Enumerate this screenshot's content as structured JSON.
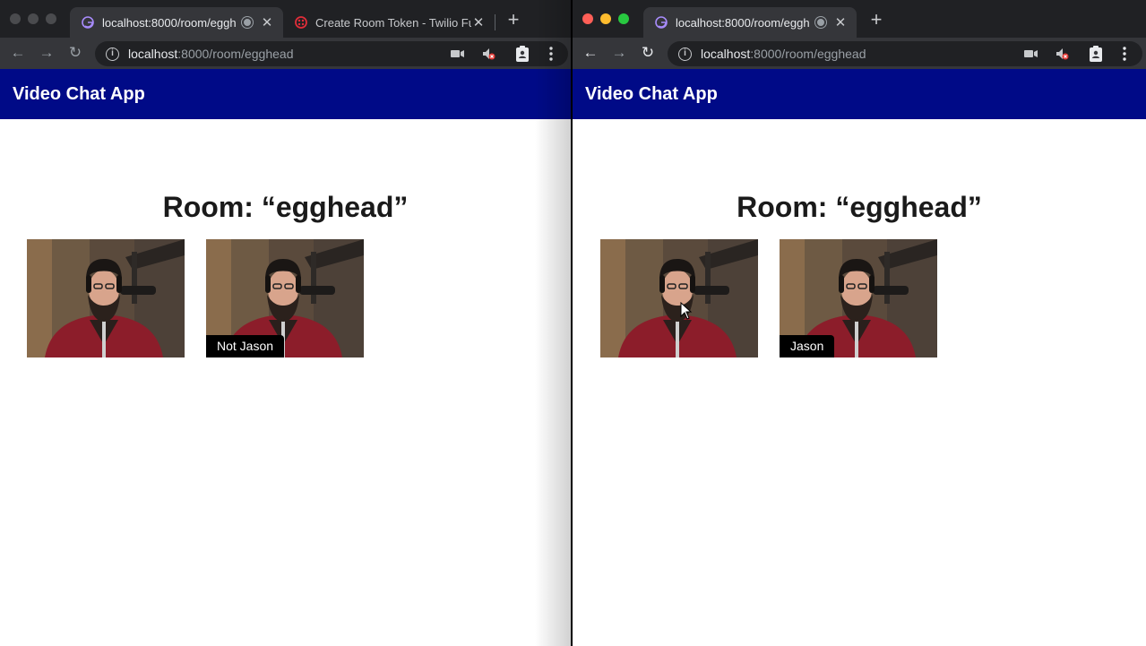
{
  "left_window": {
    "tabs": [
      {
        "title": "localhost:8000/room/eggh",
        "active": true,
        "recording": true
      },
      {
        "title": "Create Room Token - Twilio Fu",
        "active": false
      }
    ],
    "url_host": "localhost",
    "url_path": ":8000/room/egghead",
    "app_title": "Video Chat App",
    "room_title": "Room: “egghead”",
    "participants": [
      {
        "label": ""
      },
      {
        "label": "Not Jason"
      }
    ]
  },
  "right_window": {
    "tabs": [
      {
        "title": "localhost:8000/room/eggh",
        "active": true,
        "recording": true
      }
    ],
    "url_host": "localhost",
    "url_path": ":8000/room/egghead",
    "app_title": "Video Chat App",
    "room_title": "Room: “egghead”",
    "participants": [
      {
        "label": ""
      },
      {
        "label": "Jason"
      }
    ]
  },
  "colors": {
    "appbar": "#000a87",
    "tabstrip": "#202124",
    "toolbar": "#35363a"
  },
  "icons": [
    "gatsby-favicon-icon",
    "twilio-favicon-icon",
    "recording-icon",
    "close-icon",
    "new-tab-icon",
    "back-icon",
    "forward-icon",
    "reload-icon",
    "info-icon",
    "camera-icon",
    "muted-speaker-icon",
    "extension-icon",
    "menu-icon"
  ]
}
